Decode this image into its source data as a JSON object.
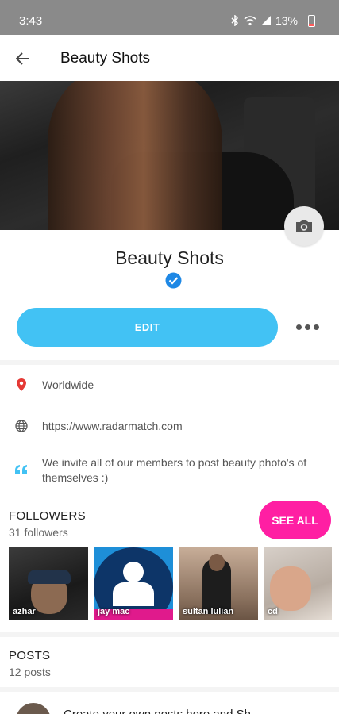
{
  "status_bar": {
    "time": "3:43",
    "battery": "13%"
  },
  "app_bar": {
    "title": "Beauty Shots"
  },
  "profile": {
    "name": "Beauty Shots",
    "edit_label": "EDIT"
  },
  "info": {
    "location": "Worldwide",
    "website": "https://www.radarmatch.com",
    "bio": "We invite all of our members to post beauty photo's of themselves :)"
  },
  "followers": {
    "title": "FOLLOWERS",
    "count": "31 followers",
    "see_all_label": "SEE ALL",
    "items": [
      {
        "name": "azhar"
      },
      {
        "name": "jay mac"
      },
      {
        "name": "sultan lulian"
      },
      {
        "name": "cd"
      }
    ]
  },
  "posts": {
    "title": "POSTS",
    "count": "12 posts",
    "first_post_preview": "Create your own posts here and Sh..."
  },
  "colors": {
    "primary": "#42c2f4",
    "accent": "#ff1fa3",
    "verified": "#1e88e5",
    "location": "#e53935"
  }
}
